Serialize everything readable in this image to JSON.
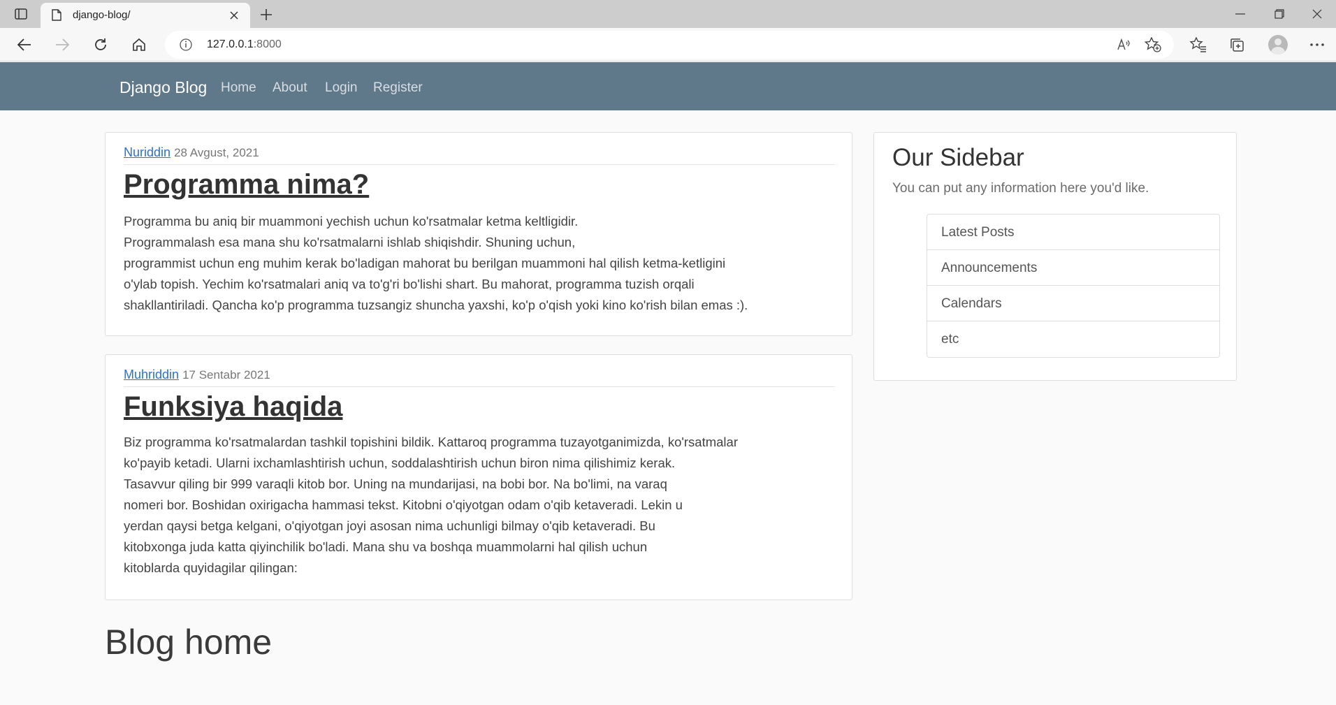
{
  "browser": {
    "tab_title": "django-blog/",
    "url_host": "127.0.0.1",
    "url_port": ":8000"
  },
  "navbar": {
    "brand": "Django Blog",
    "links": [
      "Home",
      "About",
      "Login",
      "Register"
    ],
    "bg_color": "#5f788a"
  },
  "posts": [
    {
      "author": "Nuriddin",
      "date": "28 Avgust, 2021",
      "title": "Programma nima?",
      "body": "Programma bu aniq bir muammoni yechish uchun ko'rsatmalar ketma keltligidir.\nProgrammalash esa mana shu ko'rsatmalarni ishlab shiqishdir. Shuning uchun,\nprogrammist uchun eng muhim kerak bo'ladigan mahorat bu berilgan muammoni hal qilish ketma-ketligini\no'ylab topish. Yechim ko'rsatmalari aniq va to'g'ri bo'lishi shart. Bu mahorat, programma tuzish orqali\nshakllantiriladi. Qancha ko'p programma tuzsangiz shuncha yaxshi, ko'p o'qish yoki kino ko'rish bilan emas :)."
    },
    {
      "author": "Muhriddin",
      "date": "17 Sentabr 2021",
      "title": "Funksiya haqida",
      "body": "Biz programma ko'rsatmalardan tashkil topishini bildik. Kattaroq programma tuzayotganimizda, ko'rsatmalar\nko'payib ketadi. Ularni ixchamlashtirish uchun, soddalashtirish uchun biron nima qilishimiz kerak.\nTasavvur qiling bir 999 varaqli kitob bor. Uning na mundarijasi, na bobi bor. Na bo'limi, na varaq\nnomeri bor. Boshidan oxirigacha hammasi tekst. Kitobni o'qiyotgan odam o'qib ketaveradi. Lekin u\nyerdan qaysi betga kelgani, o'qiyotgan joyi asosan nima uchunligi bilmay o'qib ketaveradi. Bu\nkitobxonga juda katta qiyinchilik bo'ladi. Mana shu va boshqa muammolarni hal qilish uchun\nkitoblarda quyidagilar qilingan:"
    }
  ],
  "sidebar": {
    "title": "Our Sidebar",
    "text": "You can put any information here you'd like.",
    "items": [
      "Latest Posts",
      "Announcements",
      "Calendars",
      "etc"
    ]
  },
  "page_heading": "Blog home",
  "colors": {
    "link": "#2a6fdb",
    "page_bg": "#fafafa"
  }
}
